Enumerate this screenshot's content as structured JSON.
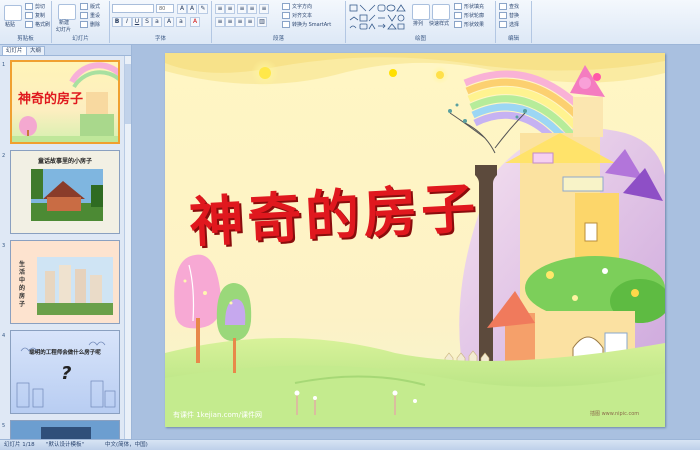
{
  "ribbon": {
    "clipboard": {
      "paste": "粘贴",
      "cut": "剪切",
      "copy": "复制",
      "format_painter": "格式刷",
      "label": "剪贴板"
    },
    "slides": {
      "new_slide": "新建",
      "new_slide_sub": "幻灯片",
      "layout": "版式",
      "reset": "重设",
      "delete": "删除",
      "label": "幻灯片"
    },
    "font": {
      "font_name": "",
      "font_size": "80",
      "label": "字体"
    },
    "paragraph": {
      "text_direction": "文字方向",
      "align_text": "对齐文本",
      "smartart": "转换为 SmartArt",
      "label": "段落"
    },
    "drawing": {
      "arrange": "排列",
      "quick_styles": "快速样式",
      "shape_fill": "形状填充",
      "shape_outline": "形状轮廓",
      "shape_effects": "形状效果",
      "label": "绘图"
    },
    "editing": {
      "find": "查找",
      "replace": "替换",
      "select": "选择",
      "label": "编辑"
    }
  },
  "panel": {
    "tabs": [
      "幻灯片",
      "大纲"
    ],
    "thumbnails": [
      {
        "num": "1",
        "title": "神奇的房子"
      },
      {
        "num": "2",
        "title": "童话故事里的小房子"
      },
      {
        "num": "3",
        "title": "生活中的房子"
      },
      {
        "num": "4",
        "title": "聪明的工程师会做什么房子呢",
        "mark": "?"
      },
      {
        "num": "5",
        "title": ""
      }
    ]
  },
  "slide": {
    "title": "神奇的房子",
    "watermark": "有课件 1kejian.com/课件网",
    "watermark_right": "插图 www.nipic.com"
  },
  "status": {
    "slide_count": "幻灯片 1/18",
    "theme": "\"默认设计模板\"",
    "language": "中文(简体，中国)"
  },
  "colors": {
    "title_red": "#e0181e",
    "ribbon": "#dde8f6",
    "selection": "#f0a030"
  }
}
